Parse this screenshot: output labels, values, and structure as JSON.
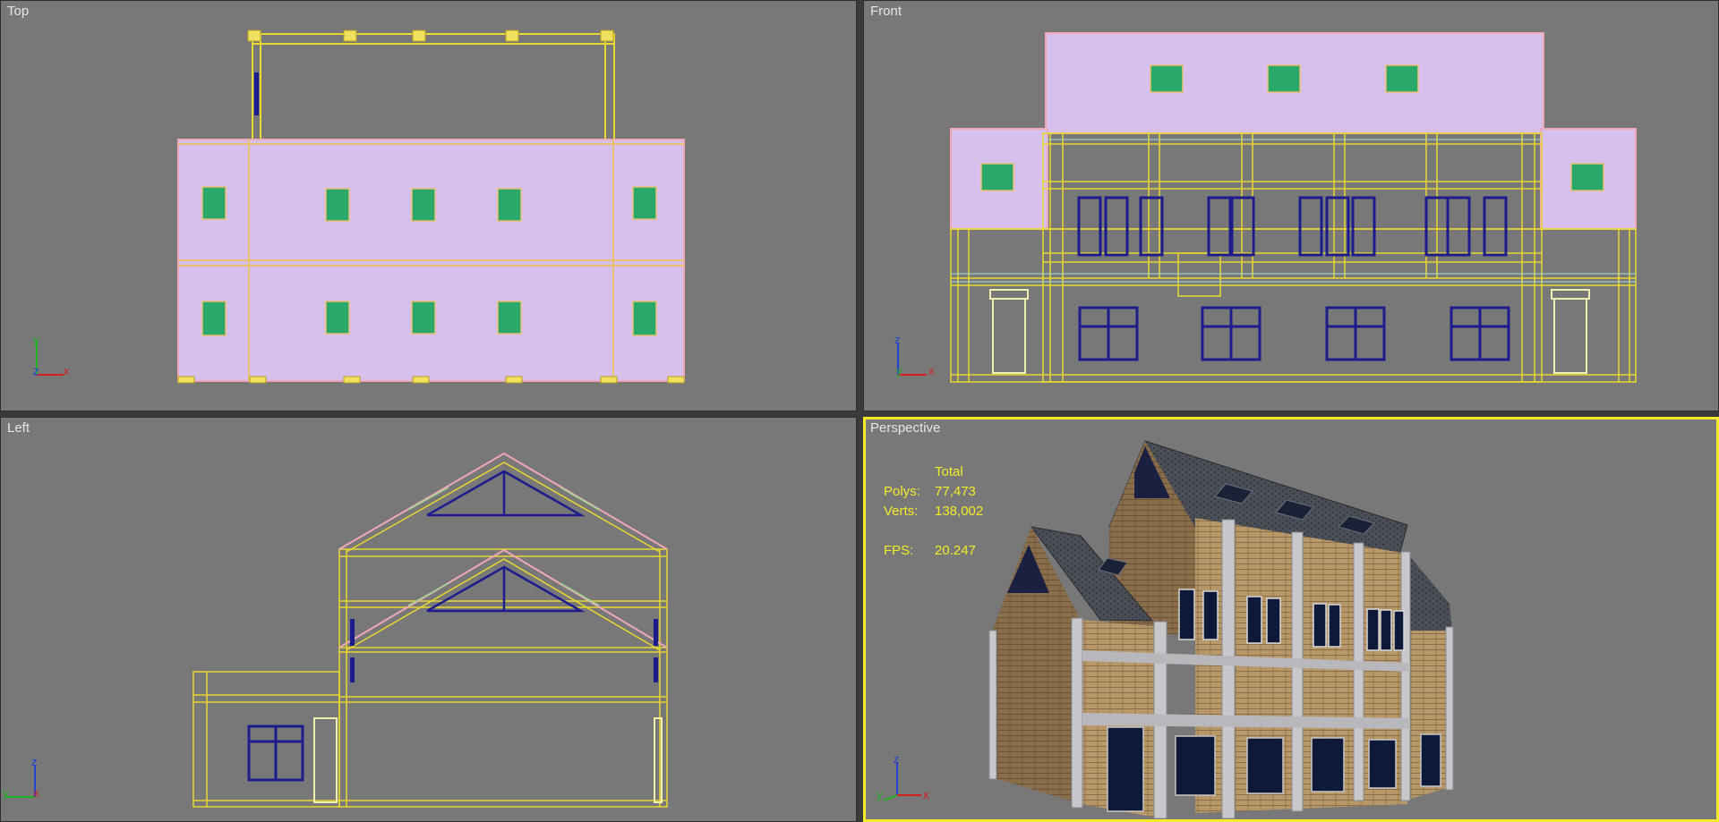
{
  "viewports": {
    "top": {
      "label": "Top"
    },
    "front": {
      "label": "Front"
    },
    "left": {
      "label": "Left"
    },
    "perspective": {
      "label": "Perspective"
    }
  },
  "axes": {
    "top": {
      "v": "y",
      "h": "x",
      "o": "z"
    },
    "front": {
      "v": "z",
      "h": "x",
      "o": "y"
    },
    "left": {
      "v": "z",
      "h": "x",
      "o": "y"
    },
    "perspective": {
      "v": "z",
      "h": "x",
      "o": "y"
    }
  },
  "stats": {
    "header": "Total",
    "polys_label": "Polys:",
    "polys_value": "77,473",
    "verts_label": "Verts:",
    "verts_value": "138,002",
    "fps_label": "FPS:",
    "fps_value": "20.247"
  },
  "colors": {
    "viewport_bg": "#787878",
    "active_border": "#f4ec2a",
    "wire_yellow": "#e8d832",
    "wall_pink": "#d8c0ec",
    "window_blue": "#1c1c8c",
    "skylight_green": "#2aa86a",
    "axis_x": "#d22020",
    "axis_y": "#20b020",
    "axis_z": "#2040d0"
  }
}
